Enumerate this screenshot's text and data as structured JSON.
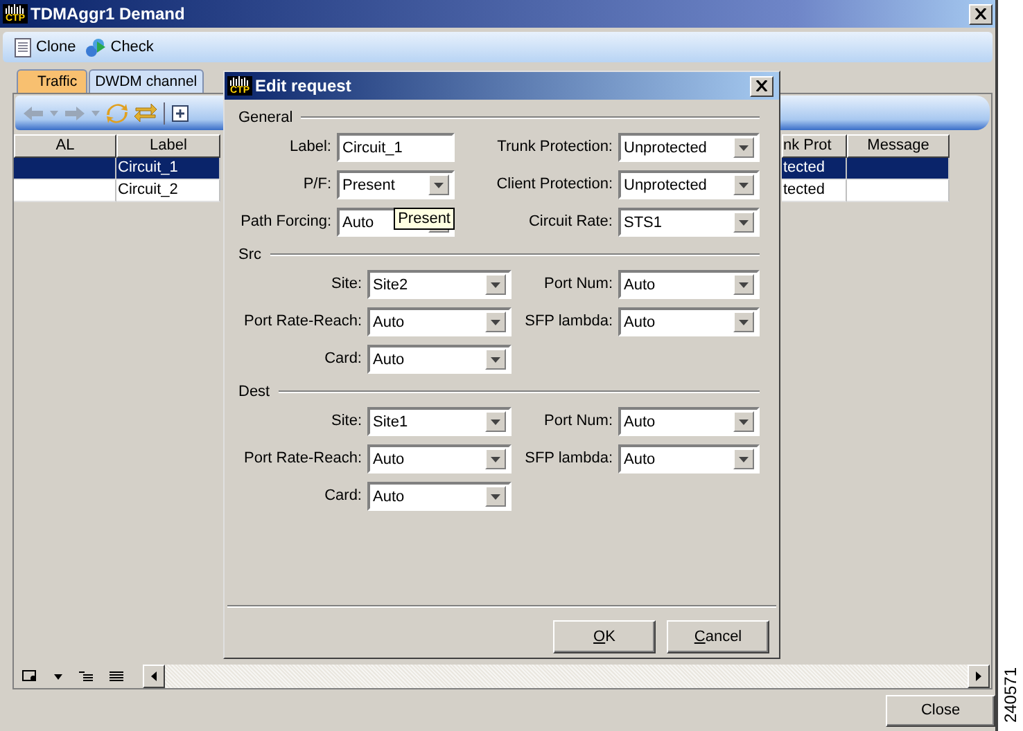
{
  "window": {
    "logo": "CTP",
    "title": "TDMAggr1 Demand"
  },
  "toolbar": [
    {
      "kind": "clone",
      "label": "Clone"
    },
    {
      "kind": "check",
      "label": "Check"
    }
  ],
  "tabs": [
    {
      "label": "Traffic",
      "selected": true
    },
    {
      "label": "DWDM channel",
      "selected": false
    }
  ],
  "table": {
    "columns": [
      "AL",
      "Label",
      "nk Prot",
      "Message"
    ],
    "rows": [
      {
        "label": "Circuit_1",
        "column_3": "tected",
        "selected": true
      },
      {
        "label": "Circuit_2",
        "column_3": "tected",
        "selected": false
      }
    ]
  },
  "dialog": {
    "logo": "CTP",
    "title": "Edit request",
    "tooltip": "Present",
    "sections": [
      {
        "title": "General",
        "rows": [
          [
            {
              "label": "Label:",
              "value": "Circuit_1",
              "kind": "text"
            },
            {
              "label": "Trunk Protection:",
              "value": "Unprotected",
              "kind": "combo"
            }
          ],
          [
            {
              "label": "P/F:",
              "value": "Present",
              "kind": "combo"
            },
            {
              "label": "Client Protection:",
              "value": "Unprotected",
              "kind": "combo"
            }
          ],
          [
            {
              "label": "Path Forcing:",
              "value": "Auto",
              "kind": "combo",
              "tooltip": true
            },
            {
              "label": "Circuit Rate:",
              "value": "STS1",
              "kind": "combo"
            }
          ]
        ]
      },
      {
        "title": "Src",
        "rows": [
          [
            {
              "label": "Site:",
              "value": "Site2",
              "kind": "combo"
            },
            {
              "label": "Port Num:",
              "value": "Auto",
              "kind": "combo"
            }
          ],
          [
            {
              "label": "Port Rate-Reach:",
              "value": "Auto",
              "kind": "combo"
            },
            {
              "label": "SFP lambda:",
              "value": "Auto",
              "kind": "combo"
            }
          ],
          [
            {
              "label": "Card:",
              "value": "Auto",
              "kind": "combo"
            }
          ]
        ]
      },
      {
        "title": "Dest",
        "rows": [
          [
            {
              "label": "Site:",
              "value": "Site1",
              "kind": "combo"
            },
            {
              "label": "Port Num:",
              "value": "Auto",
              "kind": "combo"
            }
          ],
          [
            {
              "label": "Port Rate-Reach:",
              "value": "Auto",
              "kind": "combo"
            },
            {
              "label": "SFP lambda:",
              "value": "Auto",
              "kind": "combo"
            }
          ],
          [
            {
              "label": "Card:",
              "value": "Auto",
              "kind": "combo"
            }
          ]
        ]
      }
    ],
    "buttons": [
      {
        "key": "O",
        "rest": "K"
      },
      {
        "key": "C",
        "rest": "ancel"
      }
    ]
  },
  "close_button": "Close",
  "figure_number": "240571"
}
